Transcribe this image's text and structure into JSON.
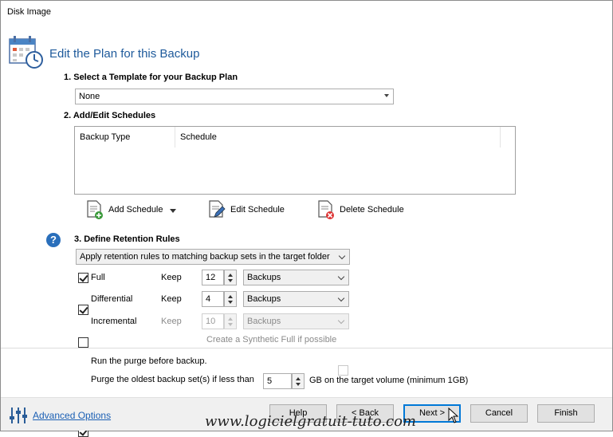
{
  "window": {
    "title": "Disk Image"
  },
  "header": {
    "title": "Edit the Plan for this Backup"
  },
  "template_section": {
    "heading": "1. Select a Template for your Backup Plan",
    "selected": "None"
  },
  "schedules_section": {
    "heading": "2. Add/Edit Schedules",
    "columns": [
      "Backup Type",
      "Schedule"
    ],
    "rows": [],
    "add_label": "Add Schedule",
    "edit_label": "Edit Schedule",
    "delete_label": "Delete Schedule"
  },
  "retention_section": {
    "heading": "3. Define Retention Rules",
    "mode": "Apply retention rules to matching backup sets in the target folder",
    "rules": [
      {
        "label": "Full",
        "checked": true,
        "keep_label": "Keep",
        "value": "12",
        "unit": "Backups",
        "enabled": true
      },
      {
        "label": "Differential",
        "checked": true,
        "keep_label": "Keep",
        "value": "4",
        "unit": "Backups",
        "enabled": true
      },
      {
        "label": "Incremental",
        "checked": false,
        "keep_label": "Keep",
        "value": "10",
        "unit": "Backups",
        "enabled": false
      }
    ],
    "synthetic_full_label": "Create a Synthetic Full if possible",
    "synthetic_full_checked": false
  },
  "purge": {
    "run_before_label": "Run the purge before backup.",
    "run_before_checked": false,
    "oldest_label": "Purge the oldest backup set(s) if less than",
    "oldest_checked": true,
    "oldest_value": "5",
    "oldest_suffix": "GB on the target volume (minimum 1GB)"
  },
  "footer": {
    "advanced_options": "Advanced Options",
    "buttons": {
      "help": "Help",
      "back": "< Back",
      "next": "Next >",
      "cancel": "Cancel",
      "finish": "Finish"
    }
  },
  "watermark": "www.logicielgratuit-tuto.com",
  "colors": {
    "accent": "#1e5a9b",
    "help_badge": "#2a6fbb",
    "default_button_border": "#0078d7"
  }
}
